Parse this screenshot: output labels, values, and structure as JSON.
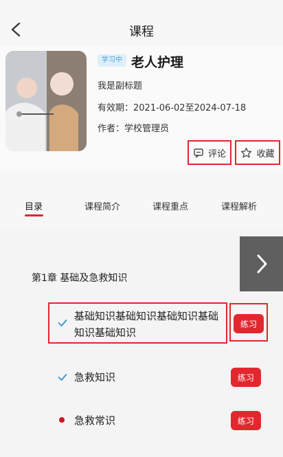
{
  "header": {
    "title": "课程"
  },
  "course": {
    "badge": "学习中",
    "title": "老人护理",
    "subtitle": "我是副标题",
    "validity_label": "有效期：",
    "validity_value": "2021-06-02至2024-07-18",
    "author_label": "作者：",
    "author_value": "学校管理员",
    "comment_label": "评论",
    "collect_label": "收藏"
  },
  "tabs": [
    {
      "label": "目录"
    },
    {
      "label": "课程简介"
    },
    {
      "label": "课程重点"
    },
    {
      "label": "课程解析"
    }
  ],
  "chapter": {
    "title": "第1章 基础及急救知识",
    "lessons": [
      {
        "title": "基础知识基础知识基础知识基础知识基础知识",
        "status": "completed",
        "action": "练习"
      },
      {
        "title": "急救知识",
        "status": "completed",
        "action": "练习"
      },
      {
        "title": "急救常识",
        "status": "in-progress",
        "action": "练习"
      }
    ]
  },
  "colors": {
    "accent": "#e0262f",
    "check": "#3b8fd6",
    "badge_bg": "#dfeff9",
    "badge_text": "#4da3d6"
  },
  "icons": {
    "back": "chevron-left-icon",
    "comment": "comment-icon",
    "collect": "star-icon",
    "collapse": "chevron-up-icon",
    "next": "chevron-right-icon",
    "completed": "check-icon"
  }
}
